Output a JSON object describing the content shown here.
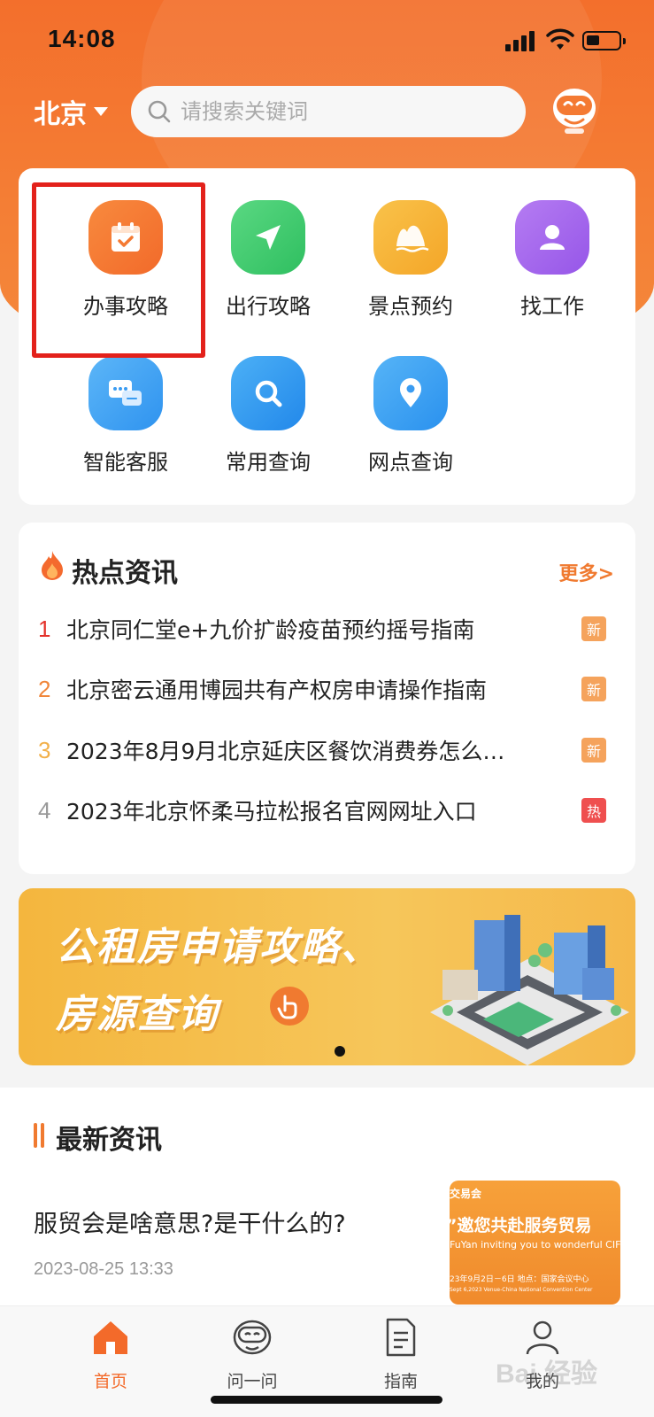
{
  "status": {
    "time": "14:08"
  },
  "header": {
    "city": "北京",
    "search_placeholder": "请搜索关键词"
  },
  "services": [
    {
      "label": "办事攻略",
      "icon": "calendar-check-icon",
      "color": "#f57a33"
    },
    {
      "label": "出行攻略",
      "icon": "send-arrow-icon",
      "color": "#3fcb70"
    },
    {
      "label": "景点预约",
      "icon": "mountain-icon",
      "color": "#f6b236"
    },
    {
      "label": "找工作",
      "icon": "person-icon",
      "color": "#a868ee"
    },
    {
      "label": "智能客服",
      "icon": "chat-bubbles-icon",
      "color": "#3ea4f4"
    },
    {
      "label": "常用查询",
      "icon": "magnifier-icon",
      "color": "#2f9df0"
    },
    {
      "label": "网点查询",
      "icon": "location-pin-icon",
      "color": "#3aa5f3"
    }
  ],
  "hot_news": {
    "title": "热点资讯",
    "more": "更多>",
    "items": [
      {
        "num": "1",
        "text": "北京同仁堂e+九价扩龄疫苗预约摇号指南",
        "badge": "新",
        "num_color": "#e3322b",
        "badge_color": "#f5a35c"
      },
      {
        "num": "2",
        "text": "北京密云通用博园共有产权房申请操作指南",
        "badge": "新",
        "num_color": "#f0863a",
        "badge_color": "#f5a35c"
      },
      {
        "num": "3",
        "text": "2023年8月9月北京延庆区餐饮消费券怎么…",
        "badge": "新",
        "num_color": "#f2b04a",
        "badge_color": "#f5a35c"
      },
      {
        "num": "4",
        "text": "2023年北京怀柔马拉松报名官网网址入口",
        "badge": "热",
        "num_color": "#999999",
        "badge_color": "#ef4f4f"
      }
    ]
  },
  "banner": {
    "line1": "公租房申请攻略、",
    "line2": "房源查询"
  },
  "latest": {
    "title": "最新资讯",
    "article_title": "服贸会是啥意思?是干什么的?",
    "article_time": "2023-08-25 13:33",
    "thumb_line1": "交易会",
    "thumb_line2": "”邀您共赴服务贸易",
    "thumb_line3": "FuYan inviting you to wonderful CIFTIS",
    "thumb_line4": "23年9月2日－6日   地点：国家会议中心",
    "thumb_line5": "Sept 6,2023      Venue-China National Convention Center"
  },
  "tabs": [
    {
      "label": "首页",
      "icon": "home-icon",
      "active": true
    },
    {
      "label": "问一问",
      "icon": "robot-icon",
      "active": false
    },
    {
      "label": "指南",
      "icon": "document-icon",
      "active": false
    },
    {
      "label": "我的",
      "icon": "user-icon",
      "active": false
    }
  ],
  "watermark": "Bai  经验"
}
